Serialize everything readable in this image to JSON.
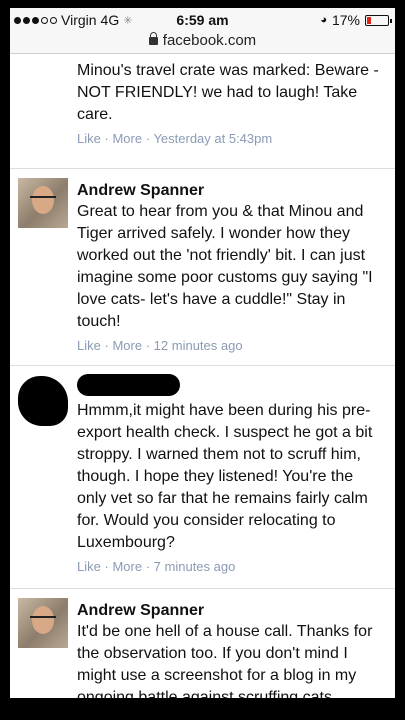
{
  "status_bar": {
    "carrier": "Virgin",
    "network": "4G",
    "time": "6:59 am",
    "battery_percent": "17%",
    "battery_level": 0.17
  },
  "url_bar": {
    "domain": "facebook.com"
  },
  "comments": [
    {
      "text": "Minou's travel crate was marked: Beware - NOT FRIENDLY! we had to laugh! Take care.",
      "like": "Like",
      "sep": "·",
      "more": "More",
      "time": "Yesterday at 5:43pm"
    },
    {
      "author": "Andrew Spanner",
      "text": "Great to hear from you & that Minou and Tiger arrived safely. I wonder how they worked out the 'not friendly' bit. I can just imagine some poor customs guy saying \"I love cats- let's have a cuddle!\" Stay in touch!",
      "like": "Like",
      "sep": "·",
      "more": "More",
      "time": "12 minutes ago"
    },
    {
      "text": "Hmmm,it might have been during his pre-export health check. I suspect he got a bit stroppy. I warned them not to scruff him, though. I hope they listened! You're the only vet so far that he remains fairly calm for. Would you consider relocating to Luxembourg?",
      "like": "Like",
      "sep": "·",
      "more": "More",
      "time": "7 minutes ago"
    },
    {
      "author": "Andrew Spanner",
      "text": "It'd be one hell of a house call. Thanks for the observation too. If you don't mind I might use a screenshot for a blog in my ongoing battle against scruffing cats."
    }
  ]
}
